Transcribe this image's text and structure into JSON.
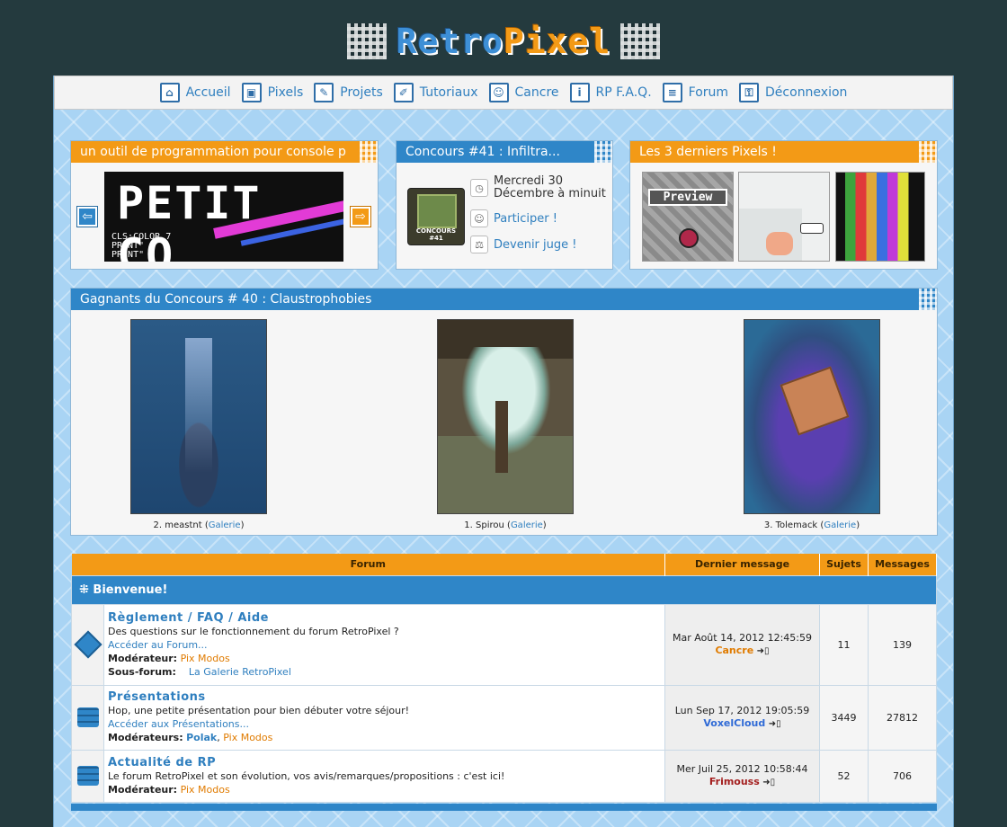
{
  "logo": {
    "part1": "Retro",
    "part2": "Pixel"
  },
  "nav": [
    {
      "label": "Accueil",
      "icon": "home-icon",
      "glyph": "⌂"
    },
    {
      "label": "Pixels",
      "icon": "box-icon",
      "glyph": "▣"
    },
    {
      "label": "Projets",
      "icon": "pencil-icon",
      "glyph": "✎"
    },
    {
      "label": "Tutoriaux",
      "icon": "ruler-icon",
      "glyph": "✐"
    },
    {
      "label": "Cancre",
      "icon": "user-icon",
      "glyph": "☺"
    },
    {
      "label": "RP F.A.Q.",
      "icon": "info-icon",
      "glyph": "i"
    },
    {
      "label": "Forum",
      "icon": "chat-icon",
      "glyph": "≡"
    },
    {
      "label": "Déconnexion",
      "icon": "lock-icon",
      "glyph": "⚿"
    }
  ],
  "tool_panel": {
    "title": "un outil de programmation pour console p",
    "banner_text": "PETIT CO",
    "code": "CLS:COLOR 7\nPRINT\"\nPRINT\"",
    "prev_glyph": "⇦",
    "next_glyph": "⇨"
  },
  "concours_panel": {
    "title": "Concours #41 : Infiltra...",
    "badge": "CONCOURS #41",
    "date_line1": "Mercredi 30",
    "date_line2": "Décembre à minuit",
    "participate": "Participer !",
    "judge": "Devenir juge !"
  },
  "pixels_panel": {
    "title": "Les 3 derniers Pixels !",
    "preview_label": "Preview"
  },
  "winners": {
    "title": "Gagnants du Concours # 40 : Claustrophobies",
    "items": [
      {
        "caption": "2. meastnt",
        "link": "Galerie"
      },
      {
        "caption": "1. Spirou",
        "link": "Galerie"
      },
      {
        "caption": "3. Tolemack",
        "link": "Galerie"
      }
    ]
  },
  "forum": {
    "headers": {
      "forum": "Forum",
      "last": "Dernier message",
      "topics": "Sujets",
      "messages": "Messages"
    },
    "category": "Bienvenue!",
    "rows": [
      {
        "title": "Règlement / FAQ / Aide",
        "desc": "Des questions sur le fonctionnement du forum RetroPixel ?",
        "link": "Accéder au Forum...",
        "mod_label": "Modérateur:",
        "mods": [
          "Pix Modos"
        ],
        "sub_label": "Sous-forum:",
        "sub": "La Galerie RetroPixel",
        "last_date": "Mar Août 14, 2012 12:45:59",
        "last_user": "Cancre",
        "last_color": "#e07b00",
        "topics": "11",
        "messages": "139"
      },
      {
        "title": "Présentations",
        "desc": "Hop, une petite présentation pour bien débuter votre séjour!",
        "link": "Accéder aux Présentations...",
        "mod_label": "Modérateurs:",
        "mods": [
          "Polak",
          "Pix Modos"
        ],
        "last_date": "Lun Sep 17, 2012 19:05:59",
        "last_user": "VoxelCloud",
        "last_color": "#2f6ad6",
        "topics": "3449",
        "messages": "27812"
      },
      {
        "title": "Actualité de RP",
        "desc": "Le forum RetroPixel et son évolution, vos avis/remarques/propositions : c'est ici!",
        "mod_label": "Modérateur:",
        "mods": [
          "Pix Modos"
        ],
        "last_date": "Mer Juil 25, 2012 10:58:44",
        "last_user": "Frimouss",
        "last_color": "#a31d1d",
        "topics": "52",
        "messages": "706"
      }
    ]
  },
  "colors": {
    "orange": "#f39a16",
    "blue": "#2f86c8",
    "bg": "#243a3e"
  }
}
